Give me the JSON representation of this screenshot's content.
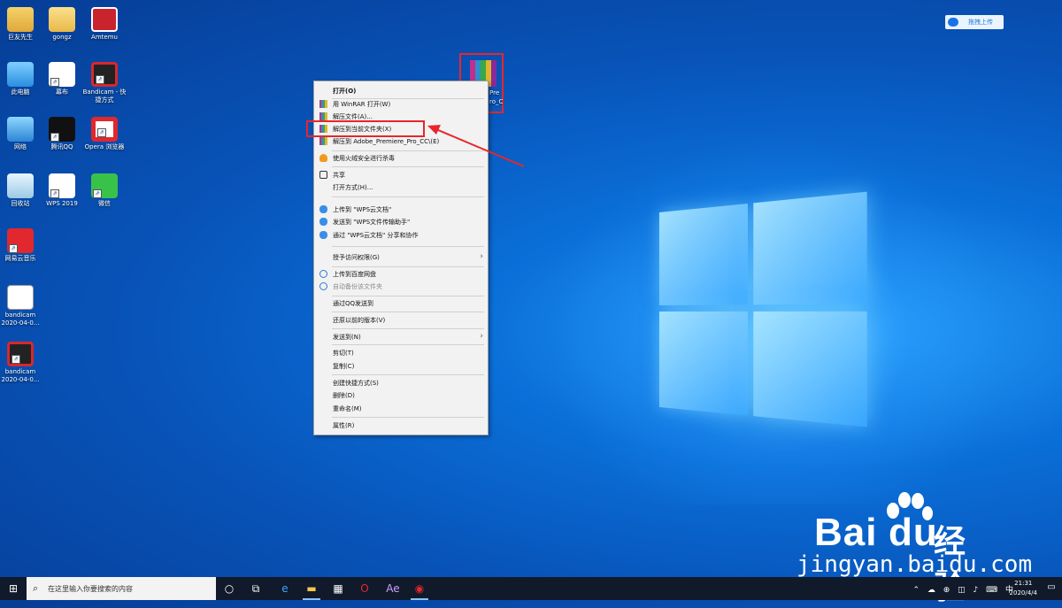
{
  "desktop": {
    "icons": [
      {
        "label": "巨友先生"
      },
      {
        "label": "gongz"
      },
      {
        "label": "Amtemu"
      },
      {
        "label": "此电脑"
      },
      {
        "label": "幕布"
      },
      {
        "label": "Bandicam - 快捷方式"
      },
      {
        "label": "网络"
      },
      {
        "label": "腾讯QQ"
      },
      {
        "label": "Opera 浏览器"
      },
      {
        "label": "回收站"
      },
      {
        "label": "WPS 2019"
      },
      {
        "label": "微信"
      },
      {
        "label": "网易云音乐"
      },
      {
        "label": "bandicam 2020-04-0..."
      },
      {
        "label": "bandicam 2020-04-0..."
      }
    ],
    "selected_file": {
      "label_line1": "Pre",
      "label_line2": "ro_C"
    },
    "upload_button": {
      "label": "拖拽上传"
    }
  },
  "context_menu": {
    "items": [
      {
        "label": "打开(O)",
        "bold": true
      },
      {
        "label": "用 WinRAR 打开(W)"
      },
      {
        "label": "解压文件(A)..."
      },
      {
        "label": "解压到当前文件夹(X)",
        "highlighted": true
      },
      {
        "label": "解压到 Adobe_Premiere_Pro_CC\\(E)"
      },
      {
        "label": "使用火绒安全进行杀毒"
      },
      {
        "label": "共享"
      },
      {
        "label": "打开方式(H)..."
      },
      {
        "label": "上传到 \"WPS云文档\""
      },
      {
        "label": "发送到 \"WPS文件传输助手\""
      },
      {
        "label": "通过 \"WPS云文档\" 分享和协作"
      },
      {
        "label": "授予访问权限(G)",
        "submenu": true
      },
      {
        "label": "上传到百度网盘"
      },
      {
        "label": "自动备份该文件夹",
        "disabled": true
      },
      {
        "label": "通过QQ发送到"
      },
      {
        "label": "还原以前的版本(V)"
      },
      {
        "label": "发送到(N)",
        "submenu": true
      },
      {
        "label": "剪切(T)"
      },
      {
        "label": "复制(C)"
      },
      {
        "label": "创建快捷方式(S)"
      },
      {
        "label": "删除(D)"
      },
      {
        "label": "重命名(M)"
      },
      {
        "label": "属性(R)"
      }
    ],
    "submenu_arrow": "›"
  },
  "watermark": {
    "brand_left": "Bai",
    "brand_right": "du",
    "product": "经验",
    "url": "jingyan.baidu.com"
  },
  "taskbar": {
    "search_placeholder": "在这里输入你要搜索的内容",
    "time": "21:31",
    "date": "2020/4/4"
  },
  "colors": {
    "highlight_border": "#e8262a",
    "menu_bg": "#f2f2f2",
    "taskbar_bg": "#101a2a"
  }
}
